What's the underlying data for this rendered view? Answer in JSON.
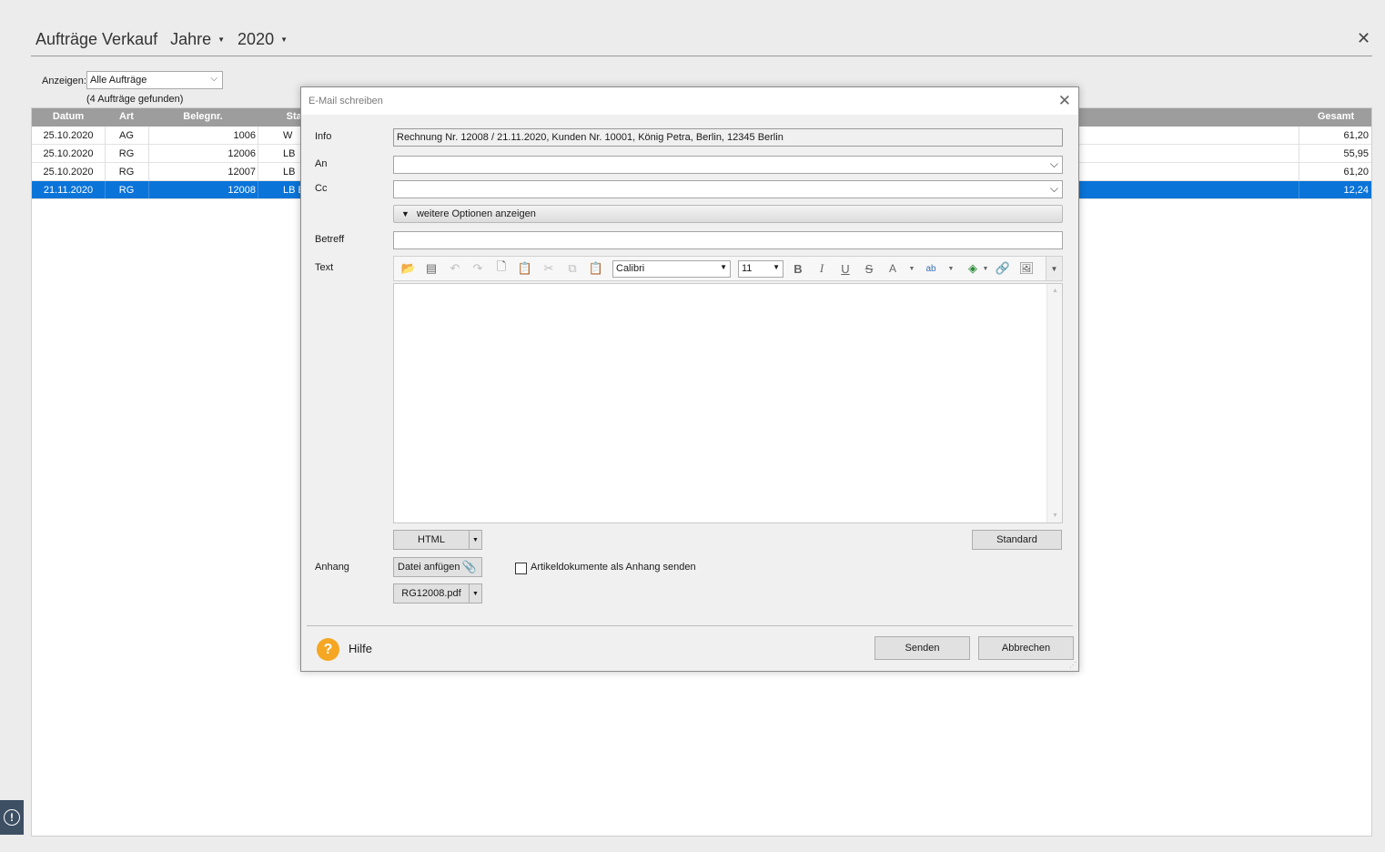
{
  "app": {
    "title": "Aufträge Verkauf",
    "period_label": "Jahre",
    "year": "2020",
    "close_glyph": "✕"
  },
  "filter": {
    "label": "Anzeigen:",
    "value": "Alle Aufträge",
    "found_text": "(4 Aufträge gefunden)"
  },
  "grid": {
    "columns": {
      "datum": "Datum",
      "art": "Art",
      "belegnr": "Belegnr.",
      "status": "Stat",
      "gesamt": "Gesamt"
    },
    "rows": [
      {
        "datum": "25.10.2020",
        "art": "AG",
        "belegnr": "1006",
        "status": "W",
        "gesamt": "61,20",
        "selected": false
      },
      {
        "datum": "25.10.2020",
        "art": "RG",
        "belegnr": "12006",
        "status": "LB",
        "gesamt": "55,95",
        "selected": false
      },
      {
        "datum": "25.10.2020",
        "art": "RG",
        "belegnr": "12007",
        "status": "LB",
        "gesamt": "61,20",
        "selected": false
      },
      {
        "datum": "21.11.2020",
        "art": "RG",
        "belegnr": "12008",
        "status": "LB E",
        "gesamt": "12,24",
        "selected": true
      }
    ],
    "selection_color": "#0a74d8"
  },
  "dialog": {
    "title": "E-Mail schreiben",
    "info_label": "Info",
    "info_value": "Rechnung Nr. 12008 / 21.11.2020, Kunden Nr. 10001, König Petra, Berlin, 12345 Berlin",
    "an_label": "An",
    "an_value": "",
    "cc_label": "Cc",
    "cc_value": "",
    "more_options": "weitere Optionen anzeigen",
    "betreff_label": "Betreff",
    "betreff_value": "",
    "text_label": "Text",
    "font_name": "Calibri",
    "font_size": "11",
    "format_button": "HTML",
    "standard_button": "Standard",
    "anhang_label": "Anhang",
    "attach_button": "Datei anfügen",
    "attachment_file": "RG12008.pdf",
    "article_docs_checkbox": "Artikeldokumente als Anhang senden",
    "article_docs_checked": false,
    "help_label": "Hilfe",
    "send_button": "Senden",
    "cancel_button": "Abbrechen"
  },
  "colors": {
    "accent_help": "#f5a623",
    "grid_header": "#9d9d9d"
  }
}
